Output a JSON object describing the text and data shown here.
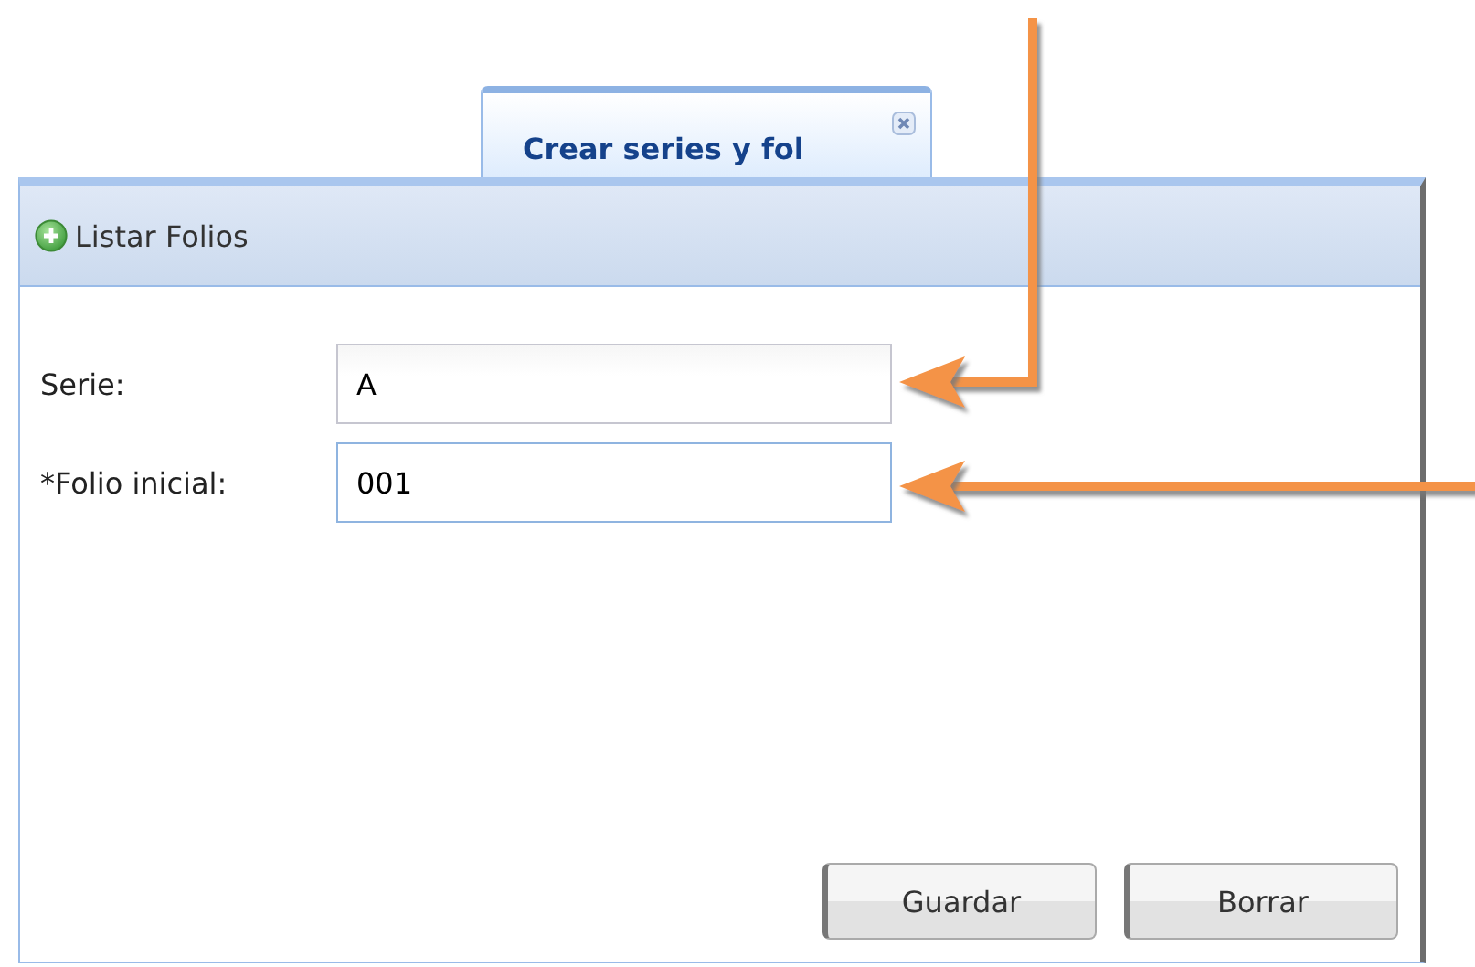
{
  "tabs": [
    {
      "label": "Crear series y fol",
      "selected": true
    }
  ],
  "toolbar": {
    "items": [
      {
        "label": "Listar Folios"
      }
    ]
  },
  "form": {
    "fields": [
      {
        "label": "Serie:",
        "value": "A",
        "focused": false
      },
      {
        "label": "*Folio inicial:",
        "value": "001",
        "focused": true
      }
    ]
  },
  "buttons": [
    "Guardar",
    "Borrar"
  ]
}
